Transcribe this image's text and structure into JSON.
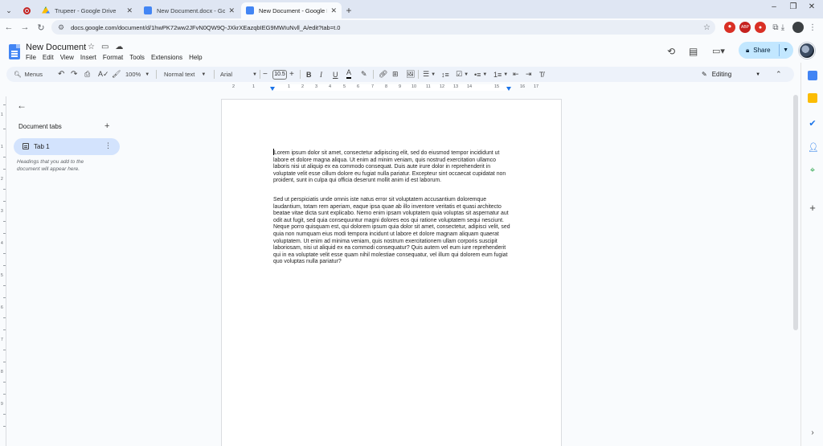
{
  "browser": {
    "tabs": [
      {
        "title": "Trupeer - Google Drive",
        "favicon": "google-drive-icon",
        "active": false
      },
      {
        "title": "New Document.docx - Google",
        "favicon": "google-docs-icon",
        "active": false
      },
      {
        "title": "New Document - Google Docs",
        "favicon": "google-docs-icon",
        "active": true
      }
    ],
    "url": "docs.google.com/document/d/1hwPK72ww2JFvN0QW9Q-JXkrXEazqbIEG9MWIuNvll_A/edit?tab=t.0"
  },
  "doc": {
    "title": "New Document",
    "menus": [
      "File",
      "Edit",
      "View",
      "Insert",
      "Format",
      "Tools",
      "Extensions",
      "Help"
    ],
    "share_label": "Share"
  },
  "toolbar": {
    "menus_label": "Menus",
    "zoom": "100%",
    "style": "Normal text",
    "font": "Arial",
    "font_size": "10.5",
    "mode": "Editing"
  },
  "ruler": {
    "labels": [
      "2",
      "1",
      "1",
      "2",
      "3",
      "4",
      "5",
      "6",
      "7",
      "8",
      "9",
      "10",
      "11",
      "12",
      "13",
      "14",
      "15",
      "16",
      "17"
    ]
  },
  "sidebar": {
    "heading": "Document tabs",
    "tab_label": "Tab 1",
    "hint": "Headings that you add to the document will appear here."
  },
  "content": {
    "paragraphs": [
      "Lorem ipsum dolor sit amet, consectetur adipiscing elit, sed do eiusmod tempor incididunt ut labore et dolore magna aliqua. Ut enim ad minim veniam, quis nostrud exercitation ullamco laboris nisi ut aliquip ex ea commodo consequat. Duis aute irure dolor in reprehenderit in voluptate velit esse cillum dolore eu fugiat nulla pariatur. Excepteur sint occaecat cupidatat non proident, sunt in culpa qui officia deserunt mollit anim id est laborum.",
      "Sed ut perspiciatis unde omnis iste natus error sit voluptatem accusantium doloremque laudantium, totam rem aperiam, eaque ipsa quae ab illo inventore veritatis et quasi architecto beatae vitae dicta sunt explicabo. Nemo enim ipsam voluptatem quia voluptas sit aspernatur aut odit aut fugit, sed quia consequuntur magni dolores eos qui ratione voluptatem sequi nesciunt. Neque porro quisquam est, qui dolorem ipsum quia dolor sit amet, consectetur, adipisci velit, sed quia non numquam eius modi tempora incidunt ut labore et dolore magnam aliquam quaerat voluptatem. Ut enim ad minima veniam, quis nostrum exercitationem ullam corporis suscipit laboriosam, nisi ut aliquid ex ea commodi consequatur? Quis autem vel eum iure reprehenderit qui in ea voluptate velit esse quam nihil molestiae consequatur, vel illum qui dolorem eum fugiat quo voluptas nulla pariatur?"
    ]
  },
  "colors": {
    "accent": "#1a73e8",
    "share_bg": "#c2e7ff",
    "tab_selected_bg": "#d3e3fd",
    "toolbar_bg": "#edf2fa"
  }
}
